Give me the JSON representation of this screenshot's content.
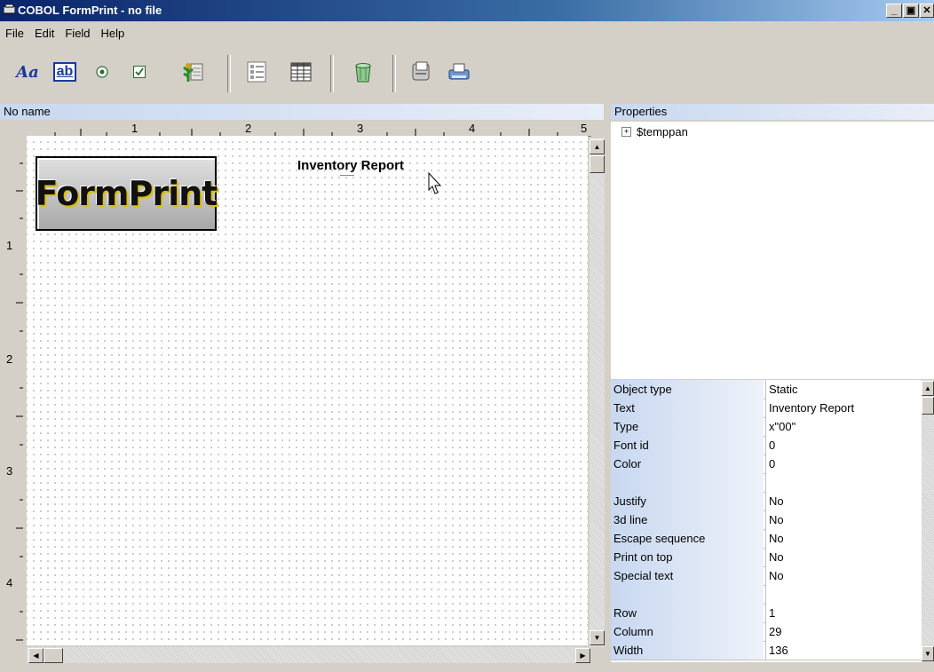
{
  "window": {
    "title": "COBOL FormPrint - no file"
  },
  "menu": [
    "File",
    "Edit",
    "Field",
    "Help"
  ],
  "toolbar": {
    "items": [
      "text-tool-icon",
      "edit-field-icon",
      "radio-button-icon",
      "checkbox-icon",
      "image-tool-icon",
      "list-options-icon",
      "table-grid-icon",
      "recycle-bin-icon",
      "print-preview-icon",
      "print-icon"
    ]
  },
  "document": {
    "header": "No name",
    "ruler_top": [
      "1",
      "2",
      "3",
      "4",
      "5"
    ],
    "ruler_left": [
      "1",
      "2",
      "3",
      "4"
    ],
    "logo_text": "FormPrint",
    "report_title": "Inventory Report"
  },
  "properties": {
    "header": "Properties",
    "tree_node": "$temppan",
    "rows": [
      {
        "name": "Object type",
        "value": "Static"
      },
      {
        "name": "Text",
        "value": "Inventory Report"
      },
      {
        "name": "Type",
        "value": "x\"00\""
      },
      {
        "name": "Font id",
        "value": "0"
      },
      {
        "name": "Color",
        "value": "0"
      },
      {
        "name": "",
        "value": ""
      },
      {
        "name": "Justify",
        "value": "No"
      },
      {
        "name": "3d line",
        "value": "No"
      },
      {
        "name": "Escape sequence",
        "value": "No"
      },
      {
        "name": "Print on top",
        "value": "No"
      },
      {
        "name": "Special text",
        "value": "No"
      },
      {
        "name": "",
        "value": ""
      },
      {
        "name": "Row",
        "value": "1"
      },
      {
        "name": "Column",
        "value": "29"
      },
      {
        "name": "Width",
        "value": "136"
      }
    ]
  }
}
